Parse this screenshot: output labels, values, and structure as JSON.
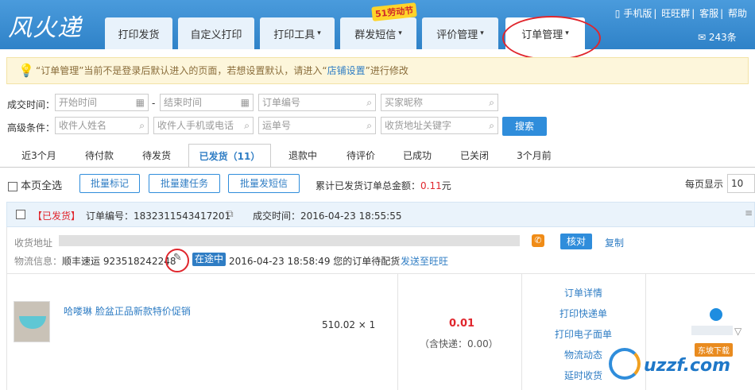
{
  "header": {
    "logo": "风火递",
    "nav": [
      "打印发货",
      "自定义打印",
      "打印工具",
      "群发短信",
      "评价管理",
      "订单管理"
    ],
    "promo_badge": "51劳动节",
    "top_links": [
      "手机版",
      "旺旺群",
      "客服",
      "帮助"
    ],
    "mail_count": "243条"
  },
  "notice": {
    "text_prefix": "“订单管理”当前不是登录后默认进入的页面，若想设置默认，请进入“",
    "link": "店铺设置",
    "text_suffix": "”进行修改"
  },
  "filters": {
    "deal_time_label": "成交时间：",
    "start_placeholder": "开始时间",
    "end_placeholder": "结束时间",
    "order_no_placeholder": "订单编号",
    "buyer_placeholder": "买家昵称",
    "advanced_label": "高级条件：",
    "receiver_name_placeholder": "收件人姓名",
    "receiver_phone_placeholder": "收件人手机或电话",
    "waybill_placeholder": "运单号",
    "address_placeholder": "收货地址关键字",
    "search_button": "搜索",
    "dash": "-"
  },
  "status_tabs": [
    "近3个月",
    "待付款",
    "待发货",
    "已发货（11）",
    "退款中",
    "待评价",
    "已成功",
    "已关闭",
    "3个月前"
  ],
  "toolbar": {
    "select_all": "本页全选",
    "batch_mark": "批量标记",
    "batch_task": "批量建任务",
    "batch_sms": "批量发短信",
    "total_label": "累计已发货订单总金额：",
    "total_value": "0.11",
    "total_unit": "元",
    "per_page_label": "每页显示",
    "per_page_value": "10"
  },
  "order": {
    "status_tag": "【已发货】",
    "order_no_label": "订单编号：",
    "order_no": "1832311543417201",
    "deal_time_label": "成交时间：",
    "deal_time": "2016-04-23 18:55:55",
    "address_label": "收货地址",
    "verify_button": "核对",
    "copy_link": "复制",
    "logistics_label": "物流信息：",
    "carrier": "顺丰速运",
    "tracking_no": "923518242248",
    "transit_badge": "在途中",
    "transit_info": "2016-04-23 18:58:49 您的订单待配货",
    "send_to_wangwang": "发送至旺旺",
    "product_title": "哈喽琳 脸盆正品新款特价促销",
    "price_qty": "510.02 × 1",
    "amount": "0.01",
    "shipping": "（含快递：0.00）",
    "actions": [
      "订单详情",
      "打印快递单",
      "打印电子面单",
      "物流动态",
      "延时收货"
    ]
  },
  "watermark": {
    "brand": "uzzf.com",
    "tag": "东坡下载"
  }
}
